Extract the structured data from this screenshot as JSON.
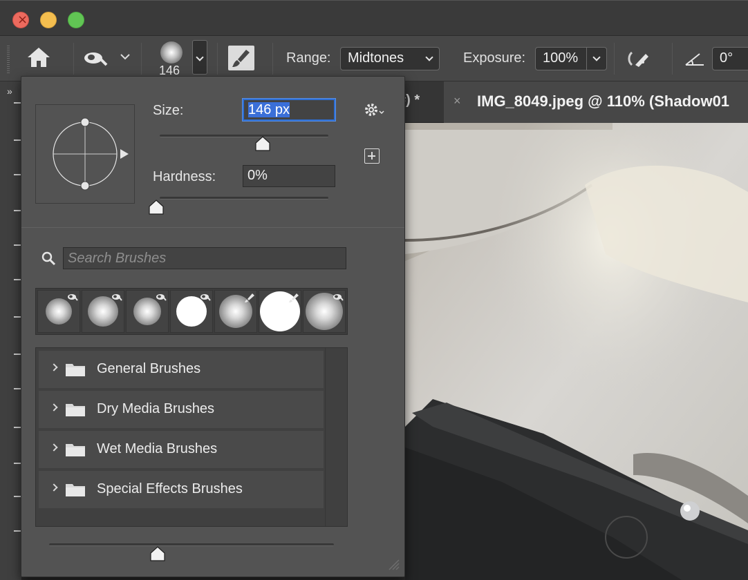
{
  "window": {
    "controls": [
      "close",
      "minimize",
      "zoom"
    ]
  },
  "options_bar": {
    "brush_size": "146",
    "range_label": "Range:",
    "range_value": "Midtones",
    "exposure_label": "Exposure:",
    "exposure_value": "100%",
    "angle_value": "0°",
    "icons": [
      "home-icon",
      "dodge-tool-icon",
      "brush-preset-icon",
      "brush-settings-icon",
      "airbrush-icon",
      "angle-icon"
    ]
  },
  "tabs": {
    "prev_tab_tail": "#) *",
    "active_tab": "IMG_8049.jpeg @ 110% (Shadow01"
  },
  "brush_panel": {
    "size_label": "Size:",
    "size_value": "146 px",
    "hardness_label": "Hardness:",
    "hardness_value": "0%",
    "size_slider_fraction": 0.61,
    "hardness_slider_fraction": 0.0,
    "preview_slider_fraction": 0.37,
    "search_placeholder": "Search Brushes",
    "preset_count": 7,
    "presets": [
      {
        "type": "soft-round",
        "badge": "dodge-icon"
      },
      {
        "type": "soft-round",
        "badge": "dodge-icon"
      },
      {
        "type": "soft-round",
        "badge": "dodge-icon"
      },
      {
        "type": "hard-round",
        "badge": "dodge-icon"
      },
      {
        "type": "soft-round",
        "badge": "brush-icon"
      },
      {
        "type": "hard-round",
        "badge": "brush-icon"
      },
      {
        "type": "soft-round",
        "badge": "dodge-icon"
      }
    ],
    "folders": [
      {
        "label": "General Brushes"
      },
      {
        "label": "Dry Media Brushes"
      },
      {
        "label": "Wet Media Brushes"
      },
      {
        "label": "Special Effects Brushes"
      }
    ]
  },
  "colors": {
    "panel_bg": "#535353",
    "selection_blue": "#3a6fd8",
    "focus_ring": "#2d6fd6"
  }
}
